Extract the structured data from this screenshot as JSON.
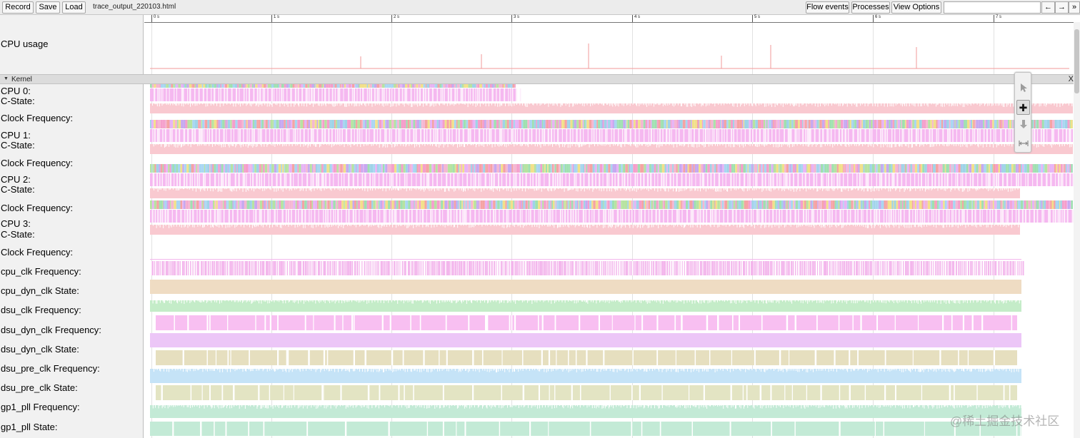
{
  "toolbar": {
    "record_label": "Record",
    "save_label": "Save",
    "load_label": "Load",
    "file_title": "trace_output_220103.html",
    "flow_events_label": "Flow events",
    "processes_label": "Processes",
    "view_options_label": "View Options",
    "search_value": "",
    "prev_label": "←",
    "next_label": "→",
    "more_label": "»"
  },
  "ruler": {
    "ticks": [
      "0 s",
      "1 s",
      "2 s",
      "3 s",
      "4 s",
      "5 s",
      "6 s",
      "7 s"
    ]
  },
  "cpu_usage": {
    "label": "CPU usage",
    "line_color": "#f29a9a"
  },
  "kernel": {
    "label": "Kernel",
    "close_label": "X",
    "collapse_icon": "triangle-down-icon"
  },
  "rows": [
    "CPU 0:",
    "C-State:",
    "Clock Frequency:",
    "CPU 1:",
    "C-State:",
    "Clock Frequency:",
    "CPU 2:",
    "C-State:",
    "Clock Frequency:",
    "CPU 3:",
    "C-State:",
    "Clock Frequency:",
    "cpu_clk Frequency:",
    "cpu_dyn_clk State:",
    "dsu_clk Frequency:",
    "dsu_dyn_clk Frequency:",
    "dsu_dyn_clk State:",
    "dsu_pre_clk Frequency:",
    "dsu_pre_clk State:",
    "gp1_pll Frequency:",
    "gp1_pll State:"
  ],
  "tools": [
    "select-icon",
    "zoom-icon",
    "pan-icon",
    "timing-icon"
  ],
  "colors": {
    "freq_pink": "#f9c9d0",
    "cstate_pink": "#f5b8f0",
    "cpu_clk_line": "#f3b6ec",
    "cpu_dyn_clk_state": "#efdcc3",
    "dsu_clk": "#c4ecc8",
    "dsu_dyn_clk_freq": "#f8bff1",
    "dsu_dyn_clk_state": "#ecc6f7",
    "dsu_pre_clk_freq": "#e6dfbf",
    "dsu_pre_clk_state": "#c5e3f7",
    "gp1_pll_freq": "#e3e4c3",
    "gp1_pll_state": "#c3ead6"
  },
  "watermark": "@稀土掘金技术社区"
}
